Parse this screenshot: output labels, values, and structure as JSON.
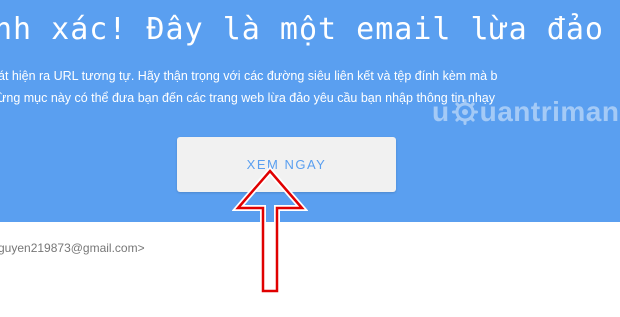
{
  "banner": {
    "headline": "nh xác! Đây là một email lừa đảo",
    "body_line_1": "át hiện ra URL tương tự. Hãy thận trọng với các đường siêu liên kết và tệp đính kèm mà b",
    "body_line_2": "ừng mục này có thể đưa bạn đến các trang web lừa đảo yêu cầu bạn nhập thông tin nhạy",
    "background_color": "#5a9ff0"
  },
  "cta": {
    "label": "XEM NGAY"
  },
  "sender": {
    "text": "guyen219873@gmail.com>"
  },
  "watermark": {
    "text_left": "u",
    "text_right": "uantrimang",
    "icon": "gear-icon"
  },
  "annotation": {
    "icon": "up-arrow-icon",
    "color": "#e00000"
  }
}
